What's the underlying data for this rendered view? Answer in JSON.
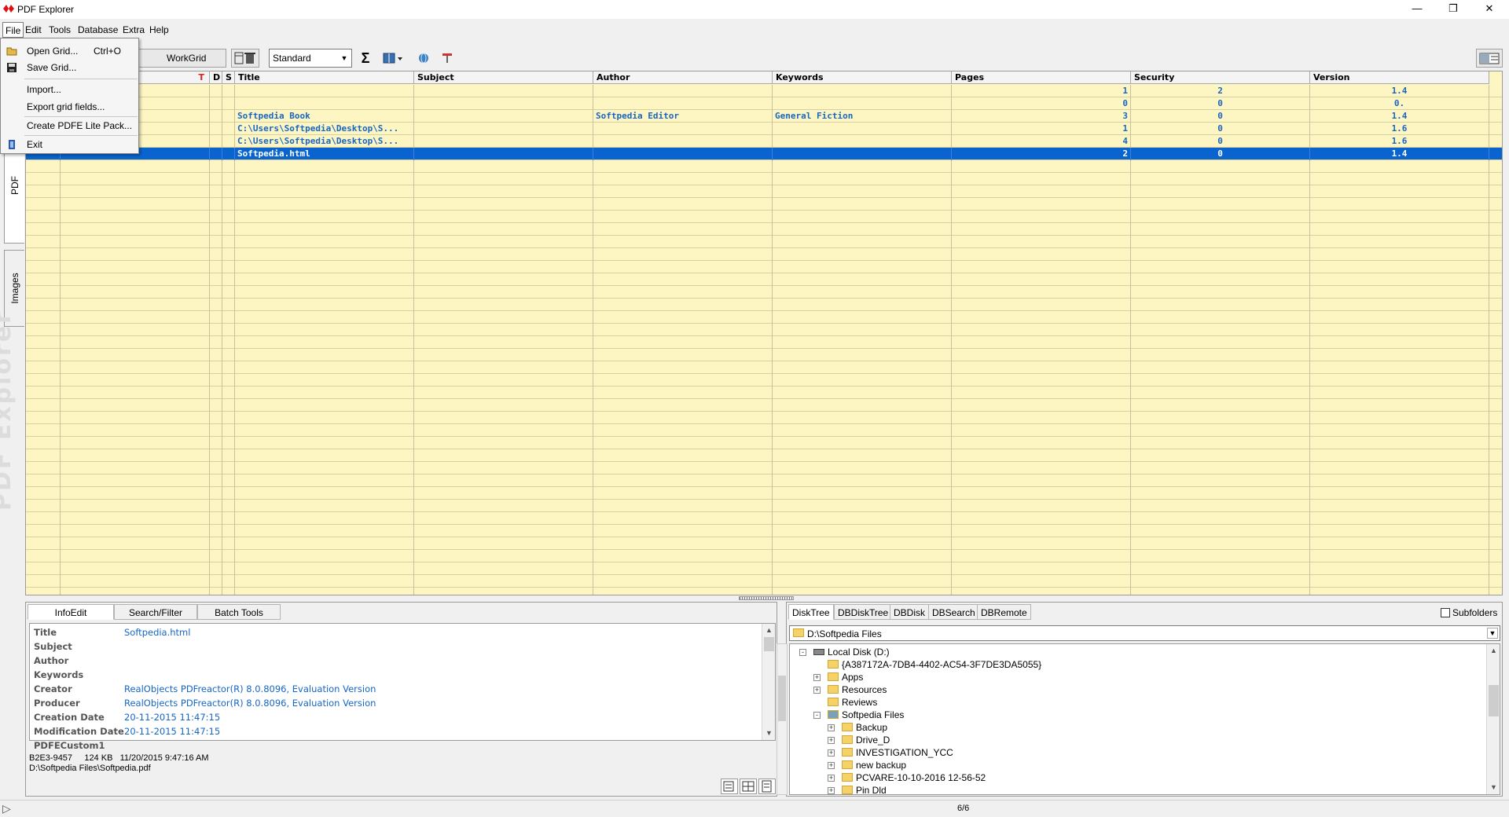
{
  "window": {
    "title": "PDF Explorer",
    "min_glyph": "—",
    "max_glyph": "❐",
    "close_glyph": "✕"
  },
  "menubar": [
    "File",
    "Edit",
    "Tools",
    "Database",
    "Extra",
    "Help"
  ],
  "file_menu": {
    "items": [
      {
        "label": "Open Grid...",
        "shortcut": "Ctrl+O"
      },
      {
        "label": "Save Grid..."
      },
      {
        "label": "Import..."
      },
      {
        "label": "Export grid fields..."
      },
      {
        "label": "Create PDFE Lite Pack..."
      },
      {
        "label": "Exit"
      }
    ]
  },
  "toolbar": {
    "workgrid_label": "WorkGrid",
    "view_combo": "Standard",
    "sigma": "Σ"
  },
  "left_tabs": {
    "pdf": "PDF",
    "images": "Images",
    "watermark": "PDF Explorer"
  },
  "grid": {
    "columns": [
      "D",
      "S",
      "Title",
      "Subject",
      "Author",
      "Keywords",
      "Pages",
      "Security",
      "Version"
    ],
    "sort_marker": "T",
    "rows": [
      {
        "file": "...f",
        "title": "",
        "subject": "",
        "author": "",
        "keywords": "",
        "pages": "1",
        "security": "2",
        "version": "1.4",
        "selected": false
      },
      {
        "file": "...es.PDF",
        "title": "",
        "subject": "",
        "author": "",
        "keywords": "",
        "pages": "0",
        "security": "0",
        "version": "0.",
        "selected": false
      },
      {
        "file": "...s.pdf",
        "title": "Softpedia Book",
        "subject": "",
        "author": "Softpedia Editor",
        "keywords": "General Fiction",
        "pages": "3",
        "security": "0",
        "version": "1.4",
        "selected": false
      },
      {
        "file": "....pdf",
        "title": "C:\\Users\\Softpedia\\Desktop\\S...",
        "subject": "",
        "author": "",
        "keywords": "",
        "pages": "1",
        "security": "0",
        "version": "1.6",
        "selected": false
      },
      {
        "file": "...sss.pdf",
        "title": "C:\\Users\\Softpedia\\Desktop\\S...",
        "subject": "",
        "author": "",
        "keywords": "",
        "pages": "4",
        "security": "0",
        "version": "1.6",
        "selected": false
      },
      {
        "file": "",
        "title": "Softpedia.html",
        "subject": "",
        "author": "",
        "keywords": "",
        "pages": "2",
        "security": "0",
        "version": "1.4",
        "selected": true
      }
    ]
  },
  "info_tabs": [
    "InfoEdit",
    "Search/Filter",
    "Batch Tools"
  ],
  "info_fields": [
    {
      "label": "Title",
      "value": "Softpedia.html"
    },
    {
      "label": "Subject",
      "value": ""
    },
    {
      "label": "Author",
      "value": ""
    },
    {
      "label": "Keywords",
      "value": ""
    },
    {
      "label": "Creator",
      "value": "RealObjects PDFreactor(R) 8.0.8096, Evaluation Version"
    },
    {
      "label": "Producer",
      "value": "RealObjects PDFreactor(R) 8.0.8096, Evaluation Version"
    },
    {
      "label": "Creation Date",
      "value": "20-11-2015 11:47:15"
    },
    {
      "label": "Modification Date",
      "value": "20-11-2015 11:47:15"
    },
    {
      "label": "PDFECustom1",
      "value": ""
    }
  ],
  "info_status": {
    "line1": "B2E3-9457     124 KB   11/20/2015 9:47:16 AM",
    "line2": "D:\\Softpedia Files\\Softpedia.pdf"
  },
  "disk_tabs": [
    "DiskTree",
    "DBDiskTree",
    "DBDisk",
    "DBSearch",
    "DBRemote"
  ],
  "subfolders_label": "Subfolders",
  "path": "D:\\Softpedia Files",
  "tree": [
    {
      "label": "Local Disk (D:)",
      "level": 1,
      "expander": "-",
      "icon": "drive"
    },
    {
      "label": "{A387172A-7DB4-4402-AC54-3F7DE3DA5055}",
      "level": 2,
      "expander": "",
      "icon": "folder"
    },
    {
      "label": "Apps",
      "level": 2,
      "expander": "+",
      "icon": "folder"
    },
    {
      "label": "Resources",
      "level": 2,
      "expander": "+",
      "icon": "folder"
    },
    {
      "label": "Reviews",
      "level": 2,
      "expander": "",
      "icon": "folder"
    },
    {
      "label": "Softpedia Files",
      "level": 2,
      "expander": "-",
      "icon": "folder-open"
    },
    {
      "label": "Backup",
      "level": 3,
      "expander": "+",
      "icon": "folder"
    },
    {
      "label": "Drive_D",
      "level": 3,
      "expander": "+",
      "icon": "folder"
    },
    {
      "label": "INVESTIGATION_YCC",
      "level": 3,
      "expander": "+",
      "icon": "folder"
    },
    {
      "label": "new backup",
      "level": 3,
      "expander": "+",
      "icon": "folder"
    },
    {
      "label": "PCVARE-10-10-2016 12-56-52",
      "level": 3,
      "expander": "+",
      "icon": "folder"
    },
    {
      "label": "Pin Dld",
      "level": 3,
      "expander": "+",
      "icon": "folder"
    }
  ],
  "statusbar": {
    "count": "6/6"
  },
  "colors": {
    "grid_bg": "#fdf6c3",
    "selection": "#0a64cf",
    "value_text": "#1566c7"
  }
}
